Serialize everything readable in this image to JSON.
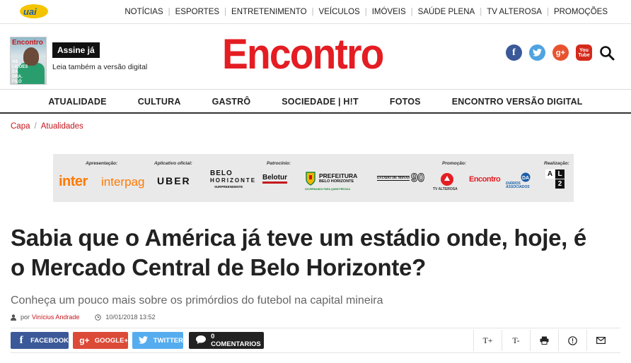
{
  "topbar": {
    "logo": "uai",
    "nav": [
      "NOTÍCIAS",
      "ESPORTES",
      "ENTRETENIMENTO",
      "VEÍCULOS",
      "IMÓVEIS",
      "SAÚDE PLENA",
      "TV ALTEROSA",
      "PROMOÇÕES"
    ]
  },
  "header": {
    "magazine_title": "Encontro",
    "magazine_cover_line": "AS LIÇÕES DA DRA. FILÓ",
    "subscribe_label": "Assine já",
    "digital_label": "Leia também a versão digital",
    "brand": "Encontro",
    "social": {
      "facebook": "f",
      "twitter": "t",
      "googleplus": "g+",
      "youtube_top": "You",
      "youtube_bottom": "Tube"
    }
  },
  "section_nav": [
    "ATUALIDADE",
    "CULTURA",
    "GASTRÔ",
    "SOCIEDADE | H!T",
    "FOTOS",
    "ENCONTRO VERSÃO DIGITAL"
  ],
  "breadcrumb": {
    "home": "Capa",
    "section": "Atualidades"
  },
  "banner": {
    "labels": {
      "apresentacao": "Apresentação:",
      "aplicativo": "Aplicativo oficial:",
      "patrocinio": "Patrocínio:",
      "promocao": "Promoção:",
      "realizacao": "Realização:"
    },
    "logos": {
      "inter": "inter",
      "interpag": "interpag",
      "uber": "UBER",
      "belo_top": "BELO",
      "belo_mid": "HORIZONTE",
      "belo_sub": "SURPREENDENTE",
      "belotur": "Belotur",
      "prefeitura_top": "PREFEITURA",
      "prefeitura_bottom": "BELO HORIZONTE",
      "prefeitura_tag": "GOVERNANDO PARA QUEM PRECISA",
      "estado": "ESTADO DE MINAS",
      "ninety": "90",
      "tv": "TV ALTEROSA",
      "encontro": "Encontro",
      "diarios": "DIÁRIOS ASSOCIADOS",
      "al_a": "A",
      "al_l": "L",
      "al_2": "2"
    }
  },
  "article": {
    "title": "Sabia que o América já teve um estádio onde, hoje, é o Mercado Central de Belo Horizonte?",
    "subtitle": "Conheça um pouco mais sobre os primórdios do futebol na capital mineira",
    "by": "por",
    "author": "Vinícius Andrade",
    "date": "10/01/2018 13:52"
  },
  "share": {
    "facebook": "FACEBOOK",
    "googleplus": "GOOGLE+",
    "twitter": "TWITTER",
    "comments": "0 COMENTARIOS",
    "font_up": "T+",
    "font_down": "T-"
  },
  "colors": {
    "brand_red": "#e41d23",
    "link_red": "#c4161c",
    "facebook": "#3b5998",
    "googleplus": "#dc4a38",
    "twitter": "#55acee"
  }
}
